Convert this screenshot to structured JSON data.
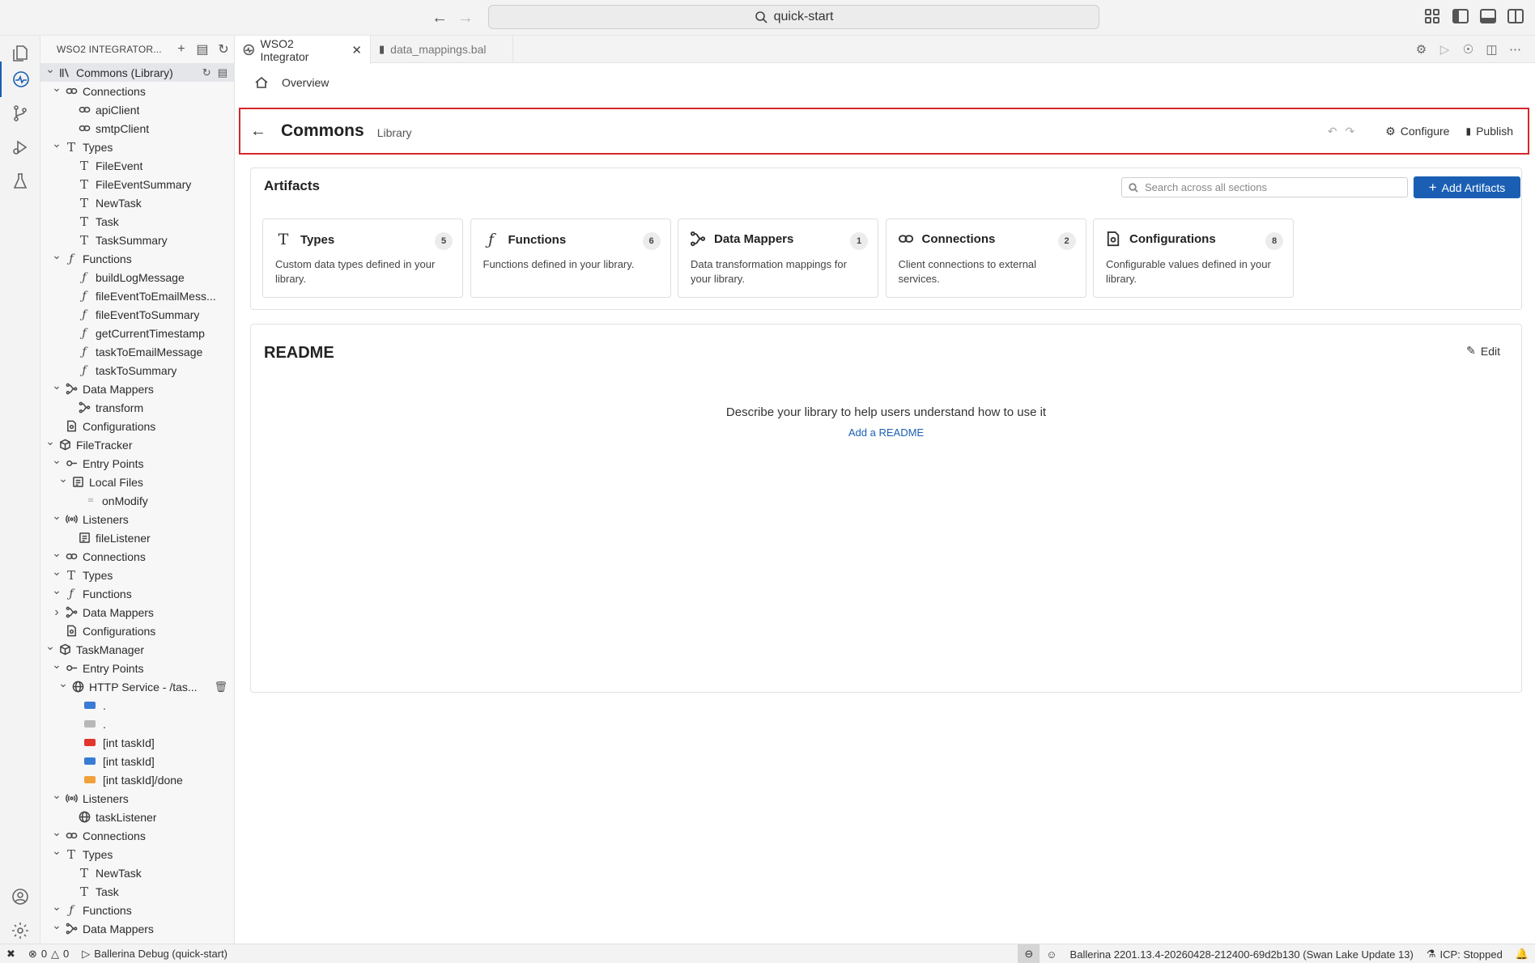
{
  "titlebar": {
    "search_text": "quick-start"
  },
  "sidebar": {
    "header_title": "WSO2 INTEGRATOR...",
    "tree": [
      {
        "label": "Commons (Library)",
        "depth": 0,
        "chev": "down",
        "icon": "library-icon",
        "selected": true,
        "buttons": true
      },
      {
        "label": "Connections",
        "depth": 1,
        "chev": "down",
        "icon": "link-icon"
      },
      {
        "label": "apiClient",
        "depth": 2,
        "chev": "",
        "icon": "link-icon"
      },
      {
        "label": "smtpClient",
        "depth": 2,
        "chev": "",
        "icon": "link-icon"
      },
      {
        "label": "Types",
        "depth": 1,
        "chev": "down",
        "icon": "type-icon"
      },
      {
        "label": "FileEvent",
        "depth": 2,
        "chev": "",
        "icon": "type-icon"
      },
      {
        "label": "FileEventSummary",
        "depth": 2,
        "chev": "",
        "icon": "type-icon"
      },
      {
        "label": "NewTask",
        "depth": 2,
        "chev": "",
        "icon": "type-icon"
      },
      {
        "label": "Task",
        "depth": 2,
        "chev": "",
        "icon": "type-icon"
      },
      {
        "label": "TaskSummary",
        "depth": 2,
        "chev": "",
        "icon": "type-icon"
      },
      {
        "label": "Functions",
        "depth": 1,
        "chev": "down",
        "icon": "function-icon"
      },
      {
        "label": "buildLogMessage",
        "depth": 2,
        "chev": "",
        "icon": "function-icon"
      },
      {
        "label": "fileEventToEmailMess...",
        "depth": 2,
        "chev": "",
        "icon": "function-icon"
      },
      {
        "label": "fileEventToSummary",
        "depth": 2,
        "chev": "",
        "icon": "function-icon"
      },
      {
        "label": "getCurrentTimestamp",
        "depth": 2,
        "chev": "",
        "icon": "function-icon"
      },
      {
        "label": "taskToEmailMessage",
        "depth": 2,
        "chev": "",
        "icon": "function-icon"
      },
      {
        "label": "taskToSummary",
        "depth": 2,
        "chev": "",
        "icon": "function-icon"
      },
      {
        "label": "Data Mappers",
        "depth": 1,
        "chev": "down",
        "icon": "data-mapper-icon"
      },
      {
        "label": "transform",
        "depth": 2,
        "chev": "",
        "icon": "data-mapper-icon"
      },
      {
        "label": "Configurations",
        "depth": 1,
        "chev": "",
        "icon": "config-file-icon"
      },
      {
        "label": "FileTracker",
        "depth": 0,
        "chev": "down",
        "icon": "package-icon"
      },
      {
        "label": "Entry Points",
        "depth": 1,
        "chev": "down",
        "icon": "entry-point-icon"
      },
      {
        "label": "Local Files",
        "depth": 2,
        "chev": "down",
        "icon": "file-listener-icon"
      },
      {
        "label": "onModify",
        "depth": 3,
        "chev": "",
        "icon": "file-icon"
      },
      {
        "label": "Listeners",
        "depth": 1,
        "chev": "down",
        "icon": "broadcast-icon"
      },
      {
        "label": "fileListener",
        "depth": 2,
        "chev": "",
        "icon": "file-listener-icon"
      },
      {
        "label": "Connections",
        "depth": 1,
        "chev": "down",
        "icon": "link-icon"
      },
      {
        "label": "Types",
        "depth": 1,
        "chev": "down",
        "icon": "type-icon"
      },
      {
        "label": "Functions",
        "depth": 1,
        "chev": "down",
        "icon": "function-icon"
      },
      {
        "label": "Data Mappers",
        "depth": 1,
        "chev": "right",
        "icon": "data-mapper-icon"
      },
      {
        "label": "Configurations",
        "depth": 1,
        "chev": "",
        "icon": "config-file-icon"
      },
      {
        "label": "TaskManager",
        "depth": 0,
        "chev": "down",
        "icon": "package-icon"
      },
      {
        "label": "Entry Points",
        "depth": 1,
        "chev": "down",
        "icon": "entry-point-icon"
      },
      {
        "label": "HTTP Service - /tas...",
        "depth": 2,
        "chev": "down",
        "icon": "globe-icon",
        "trash": true
      },
      {
        "label": ".",
        "depth": 3,
        "chev": "",
        "badge": "#3a7bd5"
      },
      {
        "label": ".",
        "depth": 3,
        "chev": "",
        "badge": "#b8b8b8"
      },
      {
        "label": "[int taskId]",
        "depth": 3,
        "chev": "",
        "badge": "#e0362c"
      },
      {
        "label": "[int taskId]",
        "depth": 3,
        "chev": "",
        "badge": "#3a7bd5"
      },
      {
        "label": "[int taskId]/done",
        "depth": 3,
        "chev": "",
        "badge": "#f0a13a"
      },
      {
        "label": "Listeners",
        "depth": 1,
        "chev": "down",
        "icon": "broadcast-icon"
      },
      {
        "label": "taskListener",
        "depth": 2,
        "chev": "",
        "icon": "globe-icon"
      },
      {
        "label": "Connections",
        "depth": 1,
        "chev": "down",
        "icon": "link-icon"
      },
      {
        "label": "Types",
        "depth": 1,
        "chev": "down",
        "icon": "type-icon"
      },
      {
        "label": "NewTask",
        "depth": 2,
        "chev": "",
        "icon": "type-icon"
      },
      {
        "label": "Task",
        "depth": 2,
        "chev": "",
        "icon": "type-icon"
      },
      {
        "label": "Functions",
        "depth": 1,
        "chev": "down",
        "icon": "function-icon"
      },
      {
        "label": "Data Mappers",
        "depth": 1,
        "chev": "down",
        "icon": "data-mapper-icon"
      }
    ]
  },
  "tabs": [
    {
      "label": "WSO2 Integrator",
      "active": true
    },
    {
      "label": "data_mappings.bal",
      "active": false
    }
  ],
  "overview": {
    "label": "Overview"
  },
  "header": {
    "title": "Commons",
    "subtitle": "Library",
    "configure": "Configure",
    "publish": "Publish"
  },
  "artifacts": {
    "title": "Artifacts",
    "search_placeholder": "Search across all sections",
    "add_button": "Add Artifacts",
    "tiles": [
      {
        "name": "Types",
        "count": "5",
        "desc": "Custom data types defined in your library.",
        "icon": "type-icon"
      },
      {
        "name": "Functions",
        "count": "6",
        "desc": "Functions defined in your library.",
        "icon": "function-icon"
      },
      {
        "name": "Data Mappers",
        "count": "1",
        "desc": "Data transformation mappings for your library.",
        "icon": "data-mapper-icon"
      },
      {
        "name": "Connections",
        "count": "2",
        "desc": "Client connections to external services.",
        "icon": "link-icon"
      },
      {
        "name": "Configurations",
        "count": "8",
        "desc": "Configurable values defined in your library.",
        "icon": "config-file-icon"
      }
    ]
  },
  "readme": {
    "title": "README",
    "edit": "Edit",
    "message": "Describe your library to help users understand how to use it",
    "link": "Add a README"
  },
  "statusbar": {
    "errors": "0",
    "warnings": "0",
    "debug": "Ballerina Debug (quick-start)",
    "version": "Ballerina 2201.13.4-20260428-212400-69d2b130 (Swan Lake Update 13)",
    "icp": "ICP: Stopped"
  },
  "colors": {
    "accent": "#1a5fb4",
    "highlight_border": "#d6262d"
  }
}
